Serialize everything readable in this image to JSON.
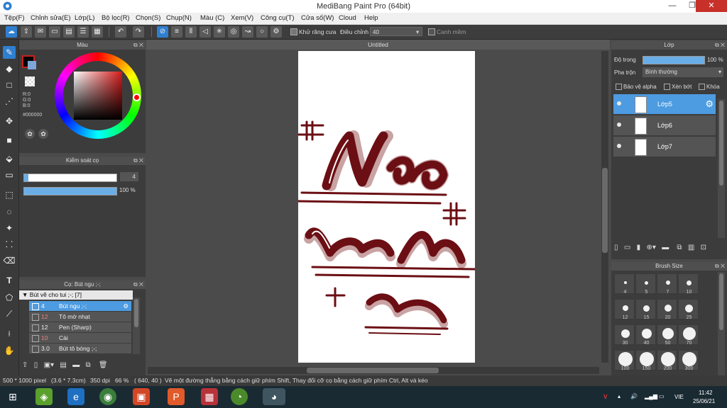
{
  "window": {
    "title": "MediBang Paint Pro (64bit)",
    "minimize": "—",
    "maximize": "❐",
    "close": "✕"
  },
  "menu": [
    "Tệp(F)",
    "Chỉnh sửa(E)",
    "Lớp(L)",
    "Bộ lọc(R)",
    "Chọn(S)",
    "Chụp(N)",
    "Màu (C)",
    "Xem(V)",
    "Công cụ(T)",
    "Cửa số(W)",
    "Cloud",
    "Help"
  ],
  "toolbar": {
    "antialias_label": "Khử răng cưa",
    "adjust_label": "Điều chỉnh",
    "adjust_value": "40",
    "grid_label": "Canh mềm"
  },
  "color_panel": {
    "title": "Màu",
    "r": "R:0",
    "g": "G:0",
    "b": "B:0",
    "hex": "#000000",
    "primary_color": "#000000",
    "secondary_color": "#7ea7d8"
  },
  "brush_control": {
    "title": "Kiểm soát cọ",
    "size_value": "4",
    "opacity_value": "100 %"
  },
  "brush_panel": {
    "title": "Cọ: Bút ngu ;-;",
    "group": "Bút vẽ cho tui ;-; [7]",
    "items": [
      {
        "size": "4",
        "name": "Bút ngu ;-;"
      },
      {
        "size": "12",
        "name": "Tô mờ nhạt"
      },
      {
        "size": "12",
        "name": "Pen (Sharp)"
      },
      {
        "size": "10",
        "name": "Cài"
      },
      {
        "size": "3.0",
        "name": "Bút tô bóng ;-;"
      }
    ]
  },
  "canvas": {
    "tab": "Untitled"
  },
  "layer_panel": {
    "title": "Lớp",
    "opacity_label": "Độ trong",
    "opacity_value": "100 %",
    "blend_label": "Pha trộn",
    "blend_value": "Bình thường",
    "protect_alpha": "Bảo vệ alpha",
    "clipping": "Xén bớt",
    "lock": "Khóa",
    "layers": [
      "Lớp5",
      "Lớp6",
      "Lớp7"
    ]
  },
  "brush_size_panel": {
    "title": "Brush Size",
    "sizes": [
      "4",
      "5",
      "7",
      "10",
      "12",
      "15",
      "20",
      "25",
      "30",
      "40",
      "50",
      "70",
      "100",
      "150",
      "200",
      "300"
    ]
  },
  "status": {
    "size": "500 * 1000 pixel",
    "cm": "(3.6 * 7.3cm)",
    "dpi": "350 dpi",
    "zoom": "66 %",
    "coords": "( 640, 40 )",
    "hint": "Vẽ một đường thẳng bằng cách giữ phím Shift, Thay đổi cỡ cọ bằng cách giữ phím Ctrl, Alt và kéo"
  },
  "taskbar": {
    "lang": "VIE",
    "time": "11:42",
    "date": "25/06/21"
  }
}
